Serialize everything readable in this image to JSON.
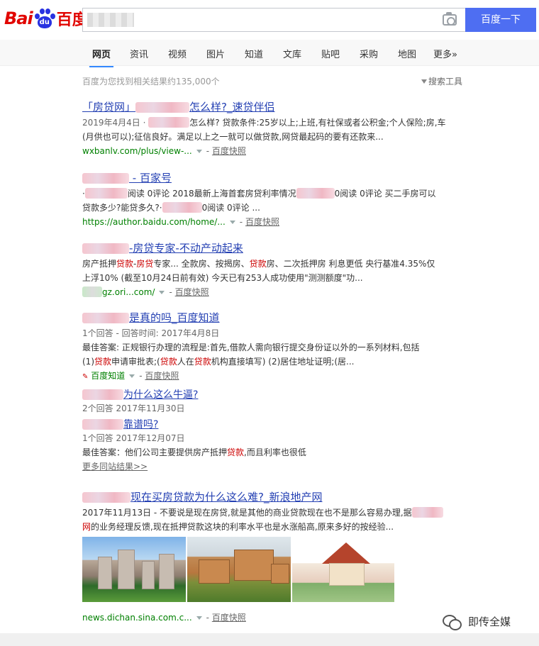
{
  "header": {
    "logo": {
      "bai": "Bai",
      "du": "du",
      "cn": "百度"
    },
    "search_button": "百度一下"
  },
  "tabs": [
    "网页",
    "资讯",
    "视频",
    "图片",
    "知道",
    "文库",
    "贴吧",
    "采购",
    "地图",
    "更多»"
  ],
  "meta": {
    "count": "百度为您找到相关结果约135,000个",
    "tools": "搜索工具"
  },
  "results": [
    {
      "title_a": "「房贷网」",
      "title_b": "怎么样?_速贷伴侣",
      "line1": "2019年4月4日 · ",
      "line1b": "怎么样? 贷款条件:25岁以上;上班,有社保或者公积金;个人保险;房,车",
      "line2": "(月供也可以);征信良好。满足以上之一就可以做贷款,网贷最起码的要有还款来...",
      "url": "wxbanlv.com/plus/view-...",
      "snap": "百度快照"
    },
    {
      "title_b": " - 百家号",
      "line1a": "·",
      "line1b": "阅读 0评论 2018最新上海首套房贷利率情况",
      "line1c": "0阅读 0评论 买二手房可以",
      "line2a": "贷款多少?能贷多久?·",
      "line2b": "0阅读 0评论 ...",
      "url": "https://author.baidu.com/home/...",
      "snap": "百度快照"
    },
    {
      "title_b": "-房贷专家-不动产动起来",
      "l1_a": "房产抵押",
      "l1_b": "贷款",
      "l1_c": "-",
      "l1_d": "房贷",
      "l1_e": "专家... 全款房、按揭房、",
      "l1_f": "贷款",
      "l1_g": "房、二次抵押房 利息更低 央行基准4.35%仅",
      "line2": "上浮10% (截至10月24日前有效) 今天已有253人成功使用\"测测额度\"功...",
      "url": "gz.ori...com/",
      "snap": "百度快照"
    },
    {
      "title_b": "是真的吗_百度知道",
      "meta": "1个回答 - 回答时间: 2017年4月8日",
      "line1": "最佳答案: 正规银行办理的流程是:首先,借款人需向银行提交身份证以外的一系列材料,包括",
      "l2_a": "(1)",
      "l2_b": "贷款",
      "l2_c": "申请审批表;(",
      "l2_d": "贷款",
      "l2_e": "人在",
      "l2_f": "贷款",
      "l2_g": "机构直接填写) (2)居住地址证明;(居...",
      "source": "百度知道",
      "snap": "百度快照"
    },
    {
      "title_b": "为什么这么牛逼?",
      "meta": "2个回答   2017年11月30日"
    },
    {
      "title_b": "靠谱吗?",
      "meta": "1个回答   2017年12月07日",
      "a_a": "最佳答案：他们公司主要提供房产抵押",
      "a_b": "贷款",
      "a_c": ",而且利率也很低"
    },
    {
      "more": "更多同站结果>>"
    },
    {
      "title_b": "现在买房贷款为什么这么难?_新浪地产网",
      "line1": "2017年11月13日 - 不要说是现在房贷,就是其他的商业贷款现在也不是那么容易办理,据",
      "l2_a": "网",
      "l2_b": "的业务经理反馈,现在抵押贷款这块的利率水平也是水涨船高,原来多好的按经验...",
      "url": "news.dichan.sina.com.c...",
      "snap": "百度快照"
    }
  ],
  "watermark": "即传全媒"
}
